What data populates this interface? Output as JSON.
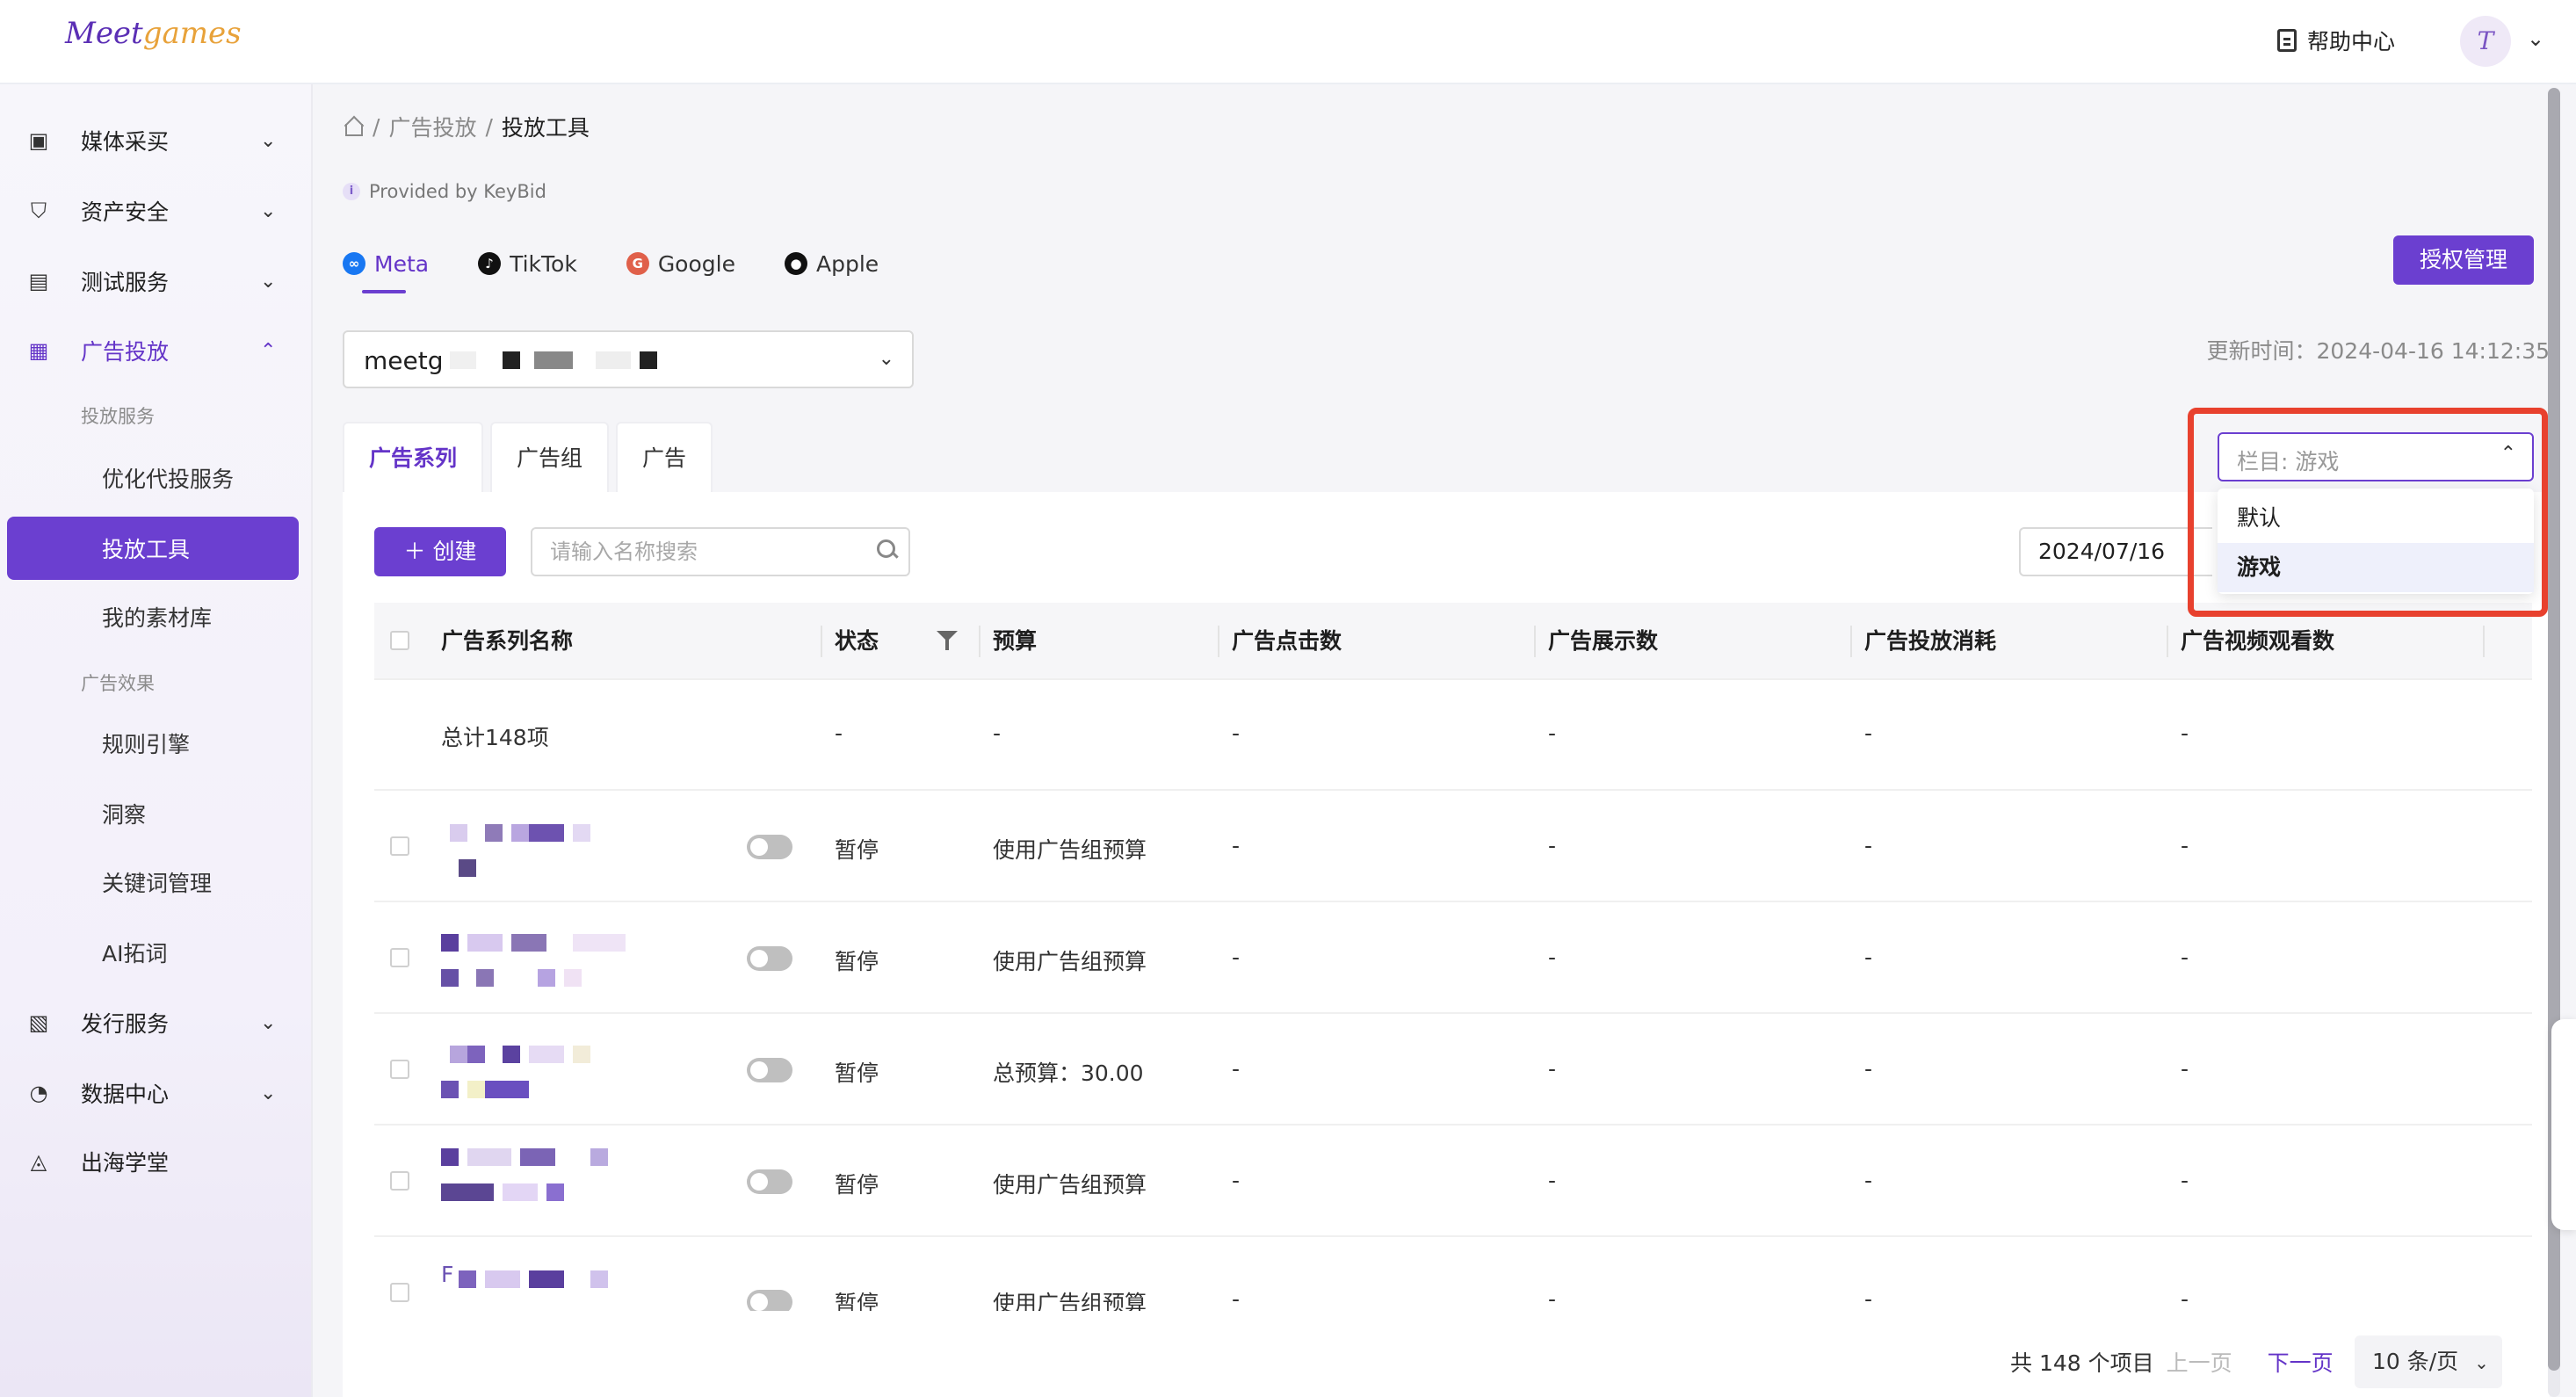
{
  "header": {
    "logo_part1": "Meet",
    "logo_part2": "games",
    "help_label": "帮助中心",
    "avatar_letter": "T"
  },
  "sidebar": {
    "items": [
      {
        "label": "媒体采买",
        "icon": "media-icon"
      },
      {
        "label": "资产安全",
        "icon": "shield-icon"
      },
      {
        "label": "测试服务",
        "icon": "folder-icon"
      },
      {
        "label": "广告投放",
        "icon": "ad-icon"
      },
      {
        "label": "发行服务",
        "icon": "publish-icon"
      },
      {
        "label": "数据中心",
        "icon": "data-icon"
      },
      {
        "label": "出海学堂",
        "icon": "school-icon"
      }
    ],
    "group_delivery": "投放服务",
    "sub_delivery": [
      "优化代投服务",
      "投放工具",
      "我的素材库"
    ],
    "group_effect": "广告效果",
    "sub_effect": [
      "规则引擎",
      "洞察",
      "关键词管理",
      "AI拓词"
    ]
  },
  "breadcrumb": {
    "sep": "/",
    "parent": "广告投放",
    "current": "投放工具"
  },
  "provided_by": "Provided by KeyBid",
  "platforms": [
    "Meta",
    "TikTok",
    "Google",
    "Apple"
  ],
  "auth_button": "授权管理",
  "account": {
    "value": "meetg"
  },
  "update_time": "更新时间：2024-04-16 14:12:35",
  "tabs": [
    "广告系列",
    "广告组",
    "广告"
  ],
  "toolbar": {
    "create": "创建",
    "search_placeholder": "请输入名称搜索",
    "date": "2024/07/16"
  },
  "column_select": {
    "value": "栏目: 游戏",
    "options": [
      "默认",
      "游戏"
    ],
    "selected": "游戏"
  },
  "table": {
    "headers": [
      "广告系列名称",
      "状态",
      "预算",
      "广告点击数",
      "广告展示数",
      "广告投放消耗",
      "广告视频观看数"
    ],
    "total_row": {
      "name": "总计148项",
      "status": "-",
      "budget": "-",
      "clicks": "-",
      "impressions": "-",
      "spend": "-",
      "views": "-"
    },
    "rows": [
      {
        "status": "暂停",
        "budget": "使用广告组预算",
        "clicks": "-",
        "impressions": "-",
        "spend": "-",
        "views": "-"
      },
      {
        "status": "暂停",
        "budget": "使用广告组预算",
        "clicks": "-",
        "impressions": "-",
        "spend": "-",
        "views": "-"
      },
      {
        "status": "暂停",
        "budget": "总预算：30.00",
        "clicks": "-",
        "impressions": "-",
        "spend": "-",
        "views": "-"
      },
      {
        "status": "暂停",
        "budget": "使用广告组预算",
        "clicks": "-",
        "impressions": "-",
        "spend": "-",
        "views": "-"
      },
      {
        "status": "暂停",
        "budget": "使用广告组预算",
        "clicks": "-",
        "impressions": "-",
        "spend": "-",
        "views": "-",
        "name_prefix": "F"
      }
    ]
  },
  "pagination": {
    "total": "共 148 个项目",
    "prev": "上一页",
    "next": "下一页",
    "page_size": "10 条/页"
  },
  "colors": {
    "accent": "#6b3fd0",
    "highlight": "#e8412e"
  }
}
